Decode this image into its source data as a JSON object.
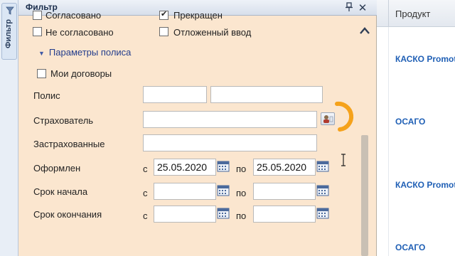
{
  "sidebar": {
    "tab_label": "Фильтр"
  },
  "panel": {
    "title": "Фильтр",
    "pin_glyph": "🖈",
    "close_glyph": "✕"
  },
  "status_checkboxes": [
    {
      "label": "Согласовано",
      "checked": false
    },
    {
      "label": "Прекращен",
      "checked": true
    },
    {
      "label": "Не согласовано",
      "checked": false
    },
    {
      "label": "Отложенный ввод",
      "checked": false
    }
  ],
  "policy_section": {
    "title": "Параметры полиса",
    "my_contracts_label": "Мои договоры",
    "policy_label": "Полис",
    "insurer_label": "Страхователь",
    "insured_label": "Застрахованные",
    "issued_label": "Оформлен",
    "start_label": "Срок начала",
    "end_label": "Срок окончания",
    "from_label": "с",
    "to_label": "по",
    "issued_from_value": "25.05.2020",
    "issued_to_value": "25.05.2020"
  },
  "grid": {
    "header": "Продукт",
    "rows": [
      "КАСКО Promot",
      "ОСАГО",
      "КАСКО Promot",
      "ОСАГО"
    ]
  },
  "colors": {
    "panel_bg": "#fbe6cf",
    "link_blue": "#1f5fb5",
    "loading_orange": "#f5a21b"
  }
}
